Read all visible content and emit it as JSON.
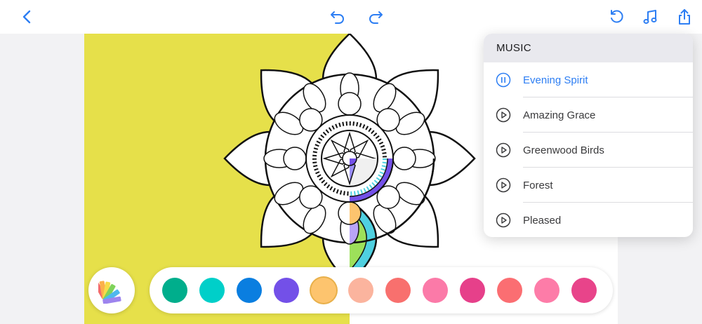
{
  "toolbar": {
    "back_icon": "chevron-left-icon",
    "undo_icon": "undo-icon",
    "redo_icon": "redo-icon",
    "reset_icon": "rotate-ccw-icon",
    "music_icon": "music-note-icon",
    "share_icon": "share-icon",
    "accent": "#2d7ef3"
  },
  "canvas": {
    "fill_color": "#e6e04a"
  },
  "music_menu": {
    "title": "MUSIC",
    "tracks": [
      {
        "label": "Evening Spirit",
        "state": "playing",
        "icon": "pause-circle-icon"
      },
      {
        "label": "Amazing Grace",
        "state": "stopped",
        "icon": "play-circle-icon"
      },
      {
        "label": "Greenwood Birds",
        "state": "stopped",
        "icon": "play-circle-icon"
      },
      {
        "label": "Forest",
        "state": "stopped",
        "icon": "play-circle-icon"
      },
      {
        "label": "Pleased",
        "state": "stopped",
        "icon": "play-circle-icon"
      }
    ]
  },
  "palette": {
    "picker_icon": "color-swatches-icon",
    "selected_index": 4,
    "colors": [
      "#00ae8c",
      "#00cfc9",
      "#0a7ee0",
      "#7350e8",
      "#fdc46e",
      "#fbb49e",
      "#f8706e",
      "#fb7aa8",
      "#e6408a",
      "#fb6e72",
      "#fd7ca8",
      "#e8448a"
    ]
  }
}
